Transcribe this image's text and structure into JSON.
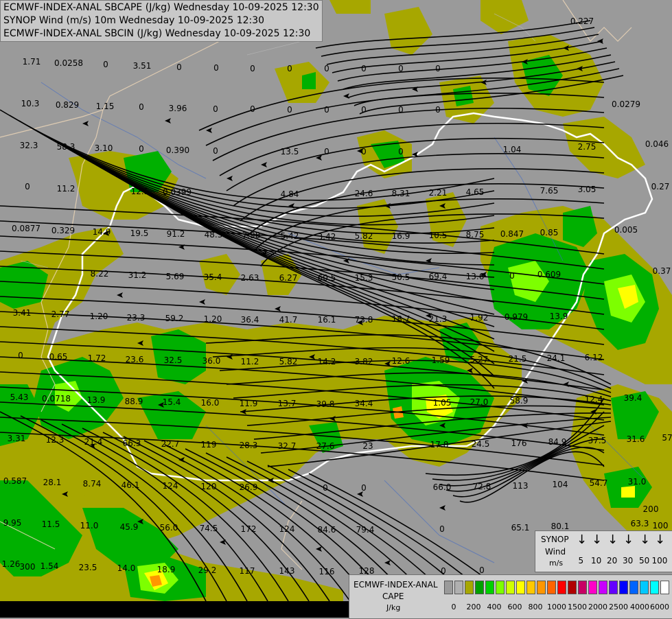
{
  "titles": [
    "ECMWF-INDEX-ANAL SBCAPE (J/kg) Wednesday 10-09-2025 12:30",
    "SYNOP Wind (m/s) 10m Wednesday 10-09-2025 12:30",
    "ECMWF-INDEX-ANAL SBCIN (J/kg) Wednesday 10-09-2025 12:30"
  ],
  "station_values": [
    "1.71",
    "0.0258",
    "0",
    "3.51",
    "0",
    "0",
    "0",
    "0",
    "0",
    "0",
    "0",
    "0",
    "10.3",
    "0.829",
    "1.15",
    "0",
    "3.96",
    "0",
    "0",
    "0",
    "0",
    "0",
    "0",
    "0",
    "32.3",
    "58.3",
    "3.10",
    "0",
    "0.390",
    "0",
    "13.5",
    "0",
    "0",
    "0",
    "1.04",
    "2.75",
    "0.046",
    "0",
    "11.2",
    "12.5",
    "0.0399",
    "4.84",
    "24.6",
    "8.31",
    "2.21",
    "4.65",
    "7.65",
    "3.05",
    "0.27",
    "0.0877",
    "0.329",
    "14.9",
    "19.5",
    "91.2",
    "48.3",
    "7.98",
    "5.42",
    "3.42",
    "5.82",
    "16.9",
    "10.5",
    "8.75",
    "0.847",
    "0.85",
    "0.005",
    "8.22",
    "31.2",
    "5.69",
    "35.4",
    "2.63",
    "6.27",
    "60.5",
    "15.3",
    "50.5",
    "69.4",
    "13.6",
    "0",
    "0.609",
    "0.37",
    "3.41",
    "2.77",
    "1.20",
    "23.3",
    "59.2",
    "1.20",
    "36.4",
    "41.7",
    "16.1",
    "73.8",
    "18.7",
    "21.3",
    "1.92",
    "0.979",
    "13.9",
    "0",
    "0.65",
    "1.72",
    "23.6",
    "32.5",
    "36.0",
    "11.2",
    "5.82",
    "14.2",
    "3.82",
    "12.6",
    "1.59",
    "5.27",
    "21.5",
    "24.1",
    "6.12",
    "5.43",
    "0.0718",
    "13.9",
    "88.9",
    "15.4",
    "16.0",
    "11.9",
    "13.7",
    "39.8",
    "34.4",
    "1.05",
    "27.0",
    "58.9",
    "12.4",
    "39.4",
    "3.31",
    "12.3",
    "21.4",
    "66.3",
    "22.7",
    "119",
    "28.3",
    "32.7",
    "27.6",
    "23",
    "17.8",
    "24.5",
    "176",
    "84.9",
    "37.5",
    "31.6",
    "57",
    "0.587",
    "28.1",
    "8.74",
    "46.1",
    "124",
    "120",
    "26.9",
    "0",
    "0",
    "66.0",
    "72.8",
    "113",
    "104",
    "54.7",
    "31.0",
    "9.95",
    "11.5",
    "11.0",
    "45.9",
    "56.0",
    "74.5",
    "172",
    "124",
    "84.6",
    "79.4",
    "0",
    "65.1",
    "80.1",
    "63.3",
    "100",
    "1.26",
    "1.54",
    "23.5",
    "14.0",
    "18.9",
    "29.2",
    "117",
    "143",
    "116",
    "128",
    "0",
    "0",
    "0.227",
    "0.0279",
    "200",
    "300"
  ],
  "wind_legend": {
    "title": "SYNOP",
    "subtitle": "Wind",
    "unit": "m/s",
    "speeds": [
      "5",
      "10",
      "20",
      "30",
      "50",
      "100"
    ]
  },
  "cape_legend": {
    "title_line1": "ECMWF-INDEX-ANAL",
    "title_line2": "CAPE",
    "unit": "J/kg",
    "colors": [
      "#9a9a9a",
      "#b0b0b0",
      "#a7a700",
      "#00a000",
      "#00d000",
      "#7dff00",
      "#d0ff00",
      "#ffff00",
      "#ffc800",
      "#ff9600",
      "#ff6400",
      "#ff0000",
      "#b00000",
      "#c80064",
      "#ff00c8",
      "#c800ff",
      "#6400ff",
      "#0000ff",
      "#0064ff",
      "#00c8ff",
      "#00ffff",
      "#ffffff"
    ],
    "ticks": [
      "0",
      "200",
      "400",
      "600",
      "800",
      "1000",
      "1500",
      "2000",
      "2500",
      "4000",
      "6000"
    ]
  },
  "colors": {
    "background": "#9a9a9a",
    "olive": "#a7a700",
    "green": "#00b000",
    "border": "#ffffff"
  }
}
